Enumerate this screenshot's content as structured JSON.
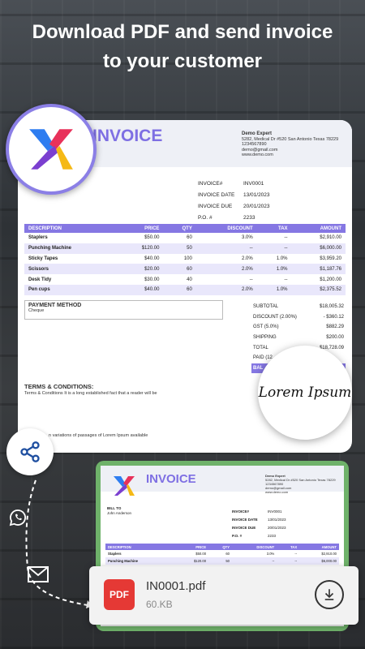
{
  "headline": [
    "Download PDF and send invoice",
    "to your customer"
  ],
  "invoice": {
    "title": "INVOICE",
    "company": {
      "name": "Demo Expert",
      "address": "5282, Medical Dr #520 San Antonio Texas 78229",
      "phone": "1234567890",
      "email": "demo@gmail.com",
      "web": "www.demo.com"
    },
    "meta": [
      {
        "k": "INVOICE#",
        "v": "INV0001"
      },
      {
        "k": "INVOICE DATE",
        "v": "13/01/2023"
      },
      {
        "k": "INVOICE DUE",
        "v": "20/01/2023"
      },
      {
        "k": "P.O. #",
        "v": "2233"
      }
    ],
    "columns": [
      "DESCRIPTION",
      "PRICE",
      "QTY",
      "DISCOUNT",
      "TAX",
      "AMOUNT"
    ],
    "rows": [
      [
        "Staplers",
        "$50.00",
        "60",
        "3.0%",
        "--",
        "$2,910.00"
      ],
      [
        "Punching Machine",
        "$120.00",
        "50",
        "--",
        "--",
        "$6,000.00"
      ],
      [
        "Sticky Tapes",
        "$40.00",
        "100",
        "2.0%",
        "1.0%",
        "$3,959.20"
      ],
      [
        "Scissors",
        "$20.00",
        "60",
        "2.0%",
        "1.0%",
        "$1,187.76"
      ],
      [
        "Desk Tidy",
        "$30.00",
        "40",
        "--",
        "--",
        "$1,200.00"
      ],
      [
        "Pen cups",
        "$40.00",
        "60",
        "2.0%",
        "1.0%",
        "$2,375.52"
      ]
    ],
    "payment_method_label": "PAYMENT METHOD",
    "payment_method_value": "Cheque",
    "totals": [
      {
        "k": "SUBTOTAL",
        "v": "$18,005.32"
      },
      {
        "k": "DISCOUNT (2.00%)",
        "v": "- $360.12"
      },
      {
        "k": "GST (5.0%)",
        "v": "$882.29"
      },
      {
        "k": "SHIPPING",
        "v": "$200.00"
      },
      {
        "k": "TOTAL",
        "v": "$18,728.09"
      },
      {
        "k": "PAID (12",
        "v": ""
      },
      {
        "k": "BAL",
        "v": ""
      }
    ],
    "terms_label": "TERMS & CONDITIONS:",
    "terms_value": "Terms & Conditions It is a long established fact that a reader will be",
    "variations_text": "n variations of passages of Lorem Ipsum available",
    "signature": "Lorem Ipsum"
  },
  "invoice2": {
    "title": "INVOICE",
    "company": {
      "name": "Demo Expert",
      "address": "5282, Medical Dr #520 San Antonio Texas 78229",
      "phone": "1234567890",
      "email": "demo@gmail.com",
      "web": "www.demo.com"
    },
    "bill_to_label": "BILL TO",
    "bill_to_name": "John Anderson",
    "meta": [
      {
        "k": "INVOICE#",
        "v": "INV0001"
      },
      {
        "k": "INVOICE DATE",
        "v": "13/01/2023"
      },
      {
        "k": "INVOICE DUE",
        "v": "20/01/2023"
      },
      {
        "k": "P.O. #",
        "v": "2233"
      }
    ],
    "columns": [
      "DESCRIPTION",
      "PRICE",
      "QTY",
      "DISCOUNT",
      "TAX",
      "AMOUNT"
    ],
    "rows": [
      [
        "Staplers",
        "$50.00",
        "60",
        "3.0%",
        "--",
        "$2,910.00"
      ],
      [
        "Punching Machine",
        "$120.00",
        "50",
        "--",
        "--",
        "$6,000.00"
      ]
    ]
  },
  "file": {
    "badge": "PDF",
    "name": "IN0001.pdf",
    "size": "60.KB"
  },
  "icons": {
    "share": "share-icon",
    "whatsapp": "whatsapp-icon",
    "email": "email-icon",
    "download": "download-icon"
  },
  "colors": {
    "accent": "#8577e3",
    "title": "#7e6fe3",
    "card2_border": "#6fb26a",
    "pdf_red": "#e53935"
  }
}
